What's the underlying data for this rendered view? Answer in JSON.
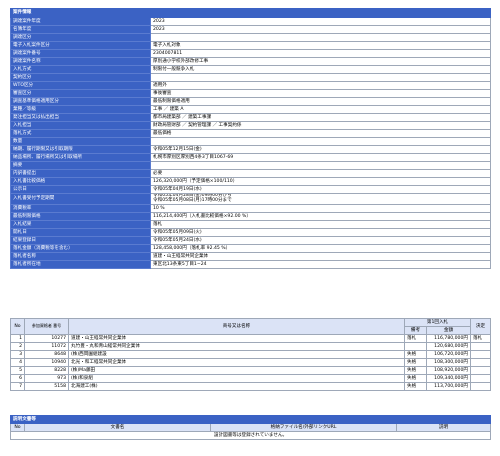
{
  "section_title": "案件情報",
  "fields": [
    {
      "label": "調達案件年度",
      "value": "2023"
    },
    {
      "label": "名簿年度",
      "value": "2023"
    },
    {
      "label": "調達区分",
      "value": ""
    },
    {
      "label": "電子入札案件区分",
      "value": "電子入札対象"
    },
    {
      "label": "調達案件番号",
      "value": "2304007811"
    },
    {
      "label": "調達案件名称",
      "value": "厚別通小学校外部改修工事"
    },
    {
      "label": "入札方式",
      "value": "制限付一般競争入札"
    },
    {
      "label": "契約区分",
      "value": ""
    },
    {
      "label": "WTO区分",
      "value": "適用外"
    },
    {
      "label": "審査区分",
      "value": "事後審査"
    },
    {
      "label": "調査基準価格適用区分",
      "value": "最低制限価格適用"
    },
    {
      "label": "業種／等級",
      "value": "工事 ／ 建築 A"
    },
    {
      "label": "発注担当又は払出担当",
      "value": "都市局建築部 ／ 建築工事課"
    },
    {
      "label": "入札担当",
      "value": "財政局管財部 ／ 契約管理課 ／ 工事契約係"
    },
    {
      "label": "落札方式",
      "value": "最低価格"
    },
    {
      "label": "数量",
      "value": ""
    },
    {
      "label": "納期、履行期限又は引取期限",
      "value": "令和05年12月15日(金)"
    },
    {
      "label": "納品場所、履行場所又は引取場所",
      "value": "札幌市厚別区厚別西4条3丁目1067-69"
    },
    {
      "label": "摘要",
      "value": ""
    },
    {
      "label": "内訳書提出",
      "value": "必要"
    },
    {
      "label": "入札書比較価格",
      "value": "126,320,000円（予定価格×100/110）"
    },
    {
      "label": "公示日",
      "value": "令和05年04月19日(水)"
    },
    {
      "label": "入札書受付予定期間",
      "value": "令和05年04月28日(金)09時00分から\n令和05年05月08日(月)17時00分まで",
      "tall": true
    },
    {
      "label": "消費税率",
      "value": "10 %"
    },
    {
      "label": "最低制限価格",
      "value": "116,214,400円（入札書比較価格×92.00 %）"
    },
    {
      "label": "入札結果",
      "value": "落札"
    },
    {
      "label": "開札日",
      "value": "令和05年05月09日(火)"
    },
    {
      "label": "結果登録日",
      "value": "令和05年05月24日(水)"
    },
    {
      "label": "落札金額（消費税等を含む）",
      "value": "128,458,000円（落札率 92.45 %）"
    },
    {
      "label": "落札者名称",
      "value": "道建・山王経常共同企業体"
    },
    {
      "label": "落札者所在地",
      "value": "東区北13条東5丁目1−24"
    }
  ],
  "results": {
    "headers": {
      "no": "No",
      "bidder_no": "参加資格者\n番号",
      "name": "商号又は名称",
      "round1": "第1回入札",
      "remarks": "備考",
      "amount": "金額",
      "decision": "決定"
    },
    "rows": [
      {
        "no": "1",
        "bidder_no": "10277",
        "name": "道建・山王経常共同企業体",
        "remarks": "落札",
        "amount": "116,780,000円",
        "decision": "落札"
      },
      {
        "no": "2",
        "bidder_no": "11072",
        "name": "丸竹豊・丸和青山経常共同企業体",
        "remarks": "",
        "amount": "120,680,000円",
        "decision": ""
      },
      {
        "no": "3",
        "bidder_no": "8648",
        "name": "(株)西岡園組建設",
        "remarks": "失格",
        "amount": "106,720,000円",
        "decision": ""
      },
      {
        "no": "4",
        "bidder_no": "10940",
        "name": "北光・和工経常共同企業体",
        "remarks": "失格",
        "amount": "108,300,000円",
        "decision": ""
      },
      {
        "no": "5",
        "bidder_no": "8228",
        "name": "(株)Ma藤田",
        "remarks": "失格",
        "amount": "108,920,000円",
        "decision": ""
      },
      {
        "no": "6",
        "bidder_no": "973",
        "name": "(株)和泉組",
        "remarks": "失格",
        "amount": "109,340,000円",
        "decision": ""
      },
      {
        "no": "7",
        "bidder_no": "5158",
        "name": "北海建工(株)",
        "remarks": "失格",
        "amount": "113,700,000円",
        "decision": ""
      }
    ]
  },
  "documents": {
    "section_title": "説明文書等",
    "headers": {
      "no": "No",
      "doc_name": "文書名",
      "file_link": "格納ファイル名/外部リンクURL",
      "description": "説明"
    },
    "empty_message": "設計図書等は登録されていません。"
  },
  "colors": {
    "header_blue": "#3b62c4",
    "subheader_blue": "#dbe3f6",
    "border": "#9ea8b8"
  }
}
